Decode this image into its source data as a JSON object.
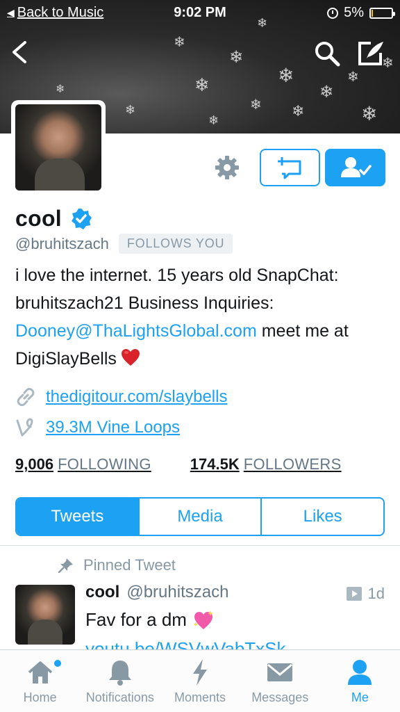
{
  "status_bar": {
    "back_label": "Back to Music",
    "time": "9:02 PM",
    "battery": "5%",
    "battery_level": 0.05
  },
  "profile": {
    "name": "cool",
    "handle": "@bruhitszach",
    "follows_you": "FOLLOWS YOU",
    "bio_part1": "i love the internet. 15 years old SnapChat: bruhitszach21 Business Inquiries: ",
    "bio_email": "Dooney@ThaLightsGlobal.com",
    "bio_part2": " meet me at DigiSlayBells",
    "website": "thedigitour.com/slaybells",
    "vine_loops": "39.3M Vine Loops",
    "following_count": "9,006",
    "following_label": "FOLLOWING",
    "followers_count": "174.5K",
    "followers_label": "FOLLOWERS"
  },
  "tabs": [
    {
      "label": "Tweets",
      "active": true
    },
    {
      "label": "Media",
      "active": false
    },
    {
      "label": "Likes",
      "active": false
    }
  ],
  "pinned_tweet": {
    "pinned_label": "Pinned Tweet",
    "name": "cool",
    "handle": "@bruhitszach",
    "time": "1d",
    "text": "Fav for a dm",
    "link": "youtu.be/WSVwVabTxSk"
  },
  "tab_bar": [
    {
      "label": "Home",
      "icon": "home-icon"
    },
    {
      "label": "Notifications",
      "icon": "bell-icon"
    },
    {
      "label": "Moments",
      "icon": "lightning-icon"
    },
    {
      "label": "Messages",
      "icon": "envelope-icon"
    },
    {
      "label": "Me",
      "icon": "person-icon"
    }
  ],
  "colors": {
    "accent": "#1da1f2",
    "muted": "#8899a6",
    "text": "#14171a"
  }
}
